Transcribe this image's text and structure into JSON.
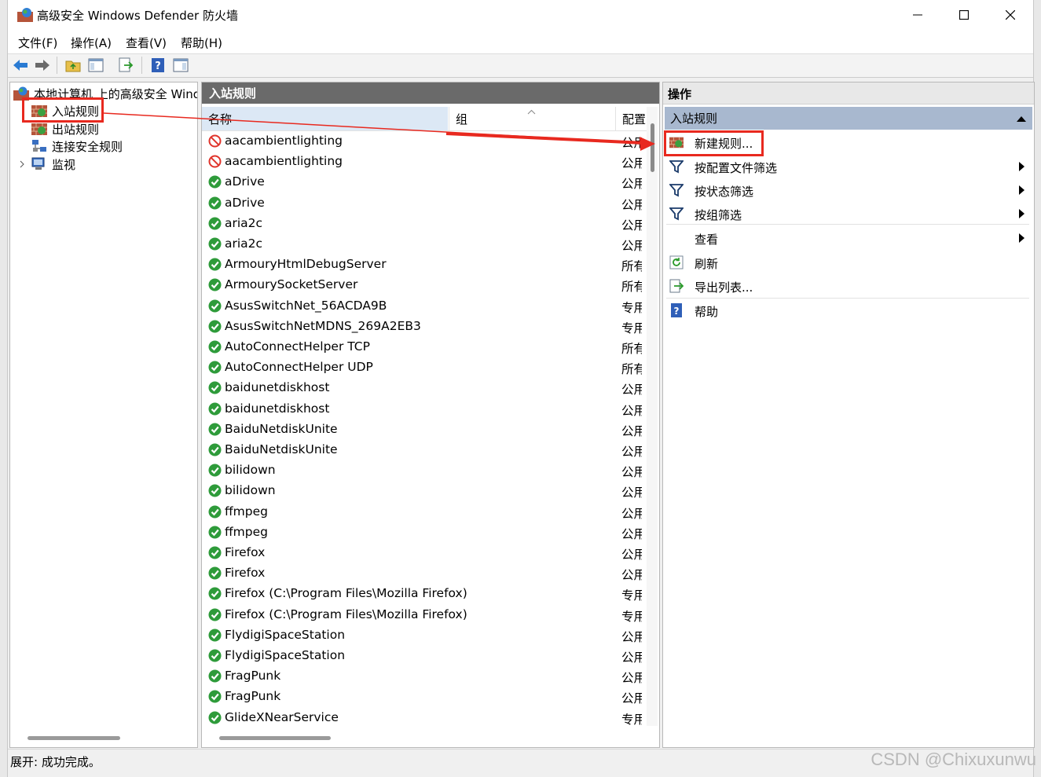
{
  "window": {
    "title": "高级安全 Windows Defender 防火墙",
    "minimize": "—",
    "maximize": "☐",
    "close": "✕"
  },
  "menu": [
    "文件(F)",
    "操作(A)",
    "查看(V)",
    "帮助(H)"
  ],
  "tree": {
    "root": "本地计算机 上的高级安全 Windows Defender 防火墙",
    "items": [
      {
        "label": "入站规则"
      },
      {
        "label": "出站规则"
      },
      {
        "label": "连接安全规则"
      },
      {
        "label": "监视"
      }
    ]
  },
  "middle": {
    "header": "入站规则",
    "columns": {
      "name": "名称",
      "group": "组",
      "profile": "配置"
    },
    "rows": [
      {
        "name": "aacambientlighting",
        "profile": "公用",
        "status": "block"
      },
      {
        "name": "aacambientlighting",
        "profile": "公用",
        "status": "block"
      },
      {
        "name": "aDrive",
        "profile": "公用",
        "status": "allow"
      },
      {
        "name": "aDrive",
        "profile": "公用",
        "status": "allow"
      },
      {
        "name": "aria2c",
        "profile": "公用",
        "status": "allow"
      },
      {
        "name": "aria2c",
        "profile": "公用",
        "status": "allow"
      },
      {
        "name": "ArmouryHtmlDebugServer",
        "profile": "所有",
        "status": "allow"
      },
      {
        "name": "ArmourySocketServer",
        "profile": "所有",
        "status": "allow"
      },
      {
        "name": "AsusSwitchNet_56ACDA9B",
        "profile": "专用",
        "status": "allow"
      },
      {
        "name": "AsusSwitchNetMDNS_269A2EB3",
        "profile": "专用",
        "status": "allow"
      },
      {
        "name": "AutoConnectHelper TCP",
        "profile": "所有",
        "status": "allow"
      },
      {
        "name": "AutoConnectHelper UDP",
        "profile": "所有",
        "status": "allow"
      },
      {
        "name": "baidunetdiskhost",
        "profile": "公用",
        "status": "allow"
      },
      {
        "name": "baidunetdiskhost",
        "profile": "公用",
        "status": "allow"
      },
      {
        "name": "BaiduNetdiskUnite",
        "profile": "公用",
        "status": "allow"
      },
      {
        "name": "BaiduNetdiskUnite",
        "profile": "公用",
        "status": "allow"
      },
      {
        "name": "bilidown",
        "profile": "公用",
        "status": "allow"
      },
      {
        "name": "bilidown",
        "profile": "公用",
        "status": "allow"
      },
      {
        "name": "ffmpeg",
        "profile": "公用",
        "status": "allow"
      },
      {
        "name": "ffmpeg",
        "profile": "公用",
        "status": "allow"
      },
      {
        "name": "Firefox",
        "profile": "公用",
        "status": "allow"
      },
      {
        "name": "Firefox",
        "profile": "公用",
        "status": "allow"
      },
      {
        "name": "Firefox (C:\\Program Files\\Mozilla Firefox)",
        "profile": "专用",
        "status": "allow"
      },
      {
        "name": "Firefox (C:\\Program Files\\Mozilla Firefox)",
        "profile": "专用",
        "status": "allow"
      },
      {
        "name": "FlydigiSpaceStation",
        "profile": "公用",
        "status": "allow"
      },
      {
        "name": "FlydigiSpaceStation",
        "profile": "公用",
        "status": "allow"
      },
      {
        "name": "FragPunk",
        "profile": "公用",
        "status": "allow"
      },
      {
        "name": "FragPunk",
        "profile": "公用",
        "status": "allow"
      },
      {
        "name": "GlideXNearService",
        "profile": "专用",
        "status": "allow"
      }
    ]
  },
  "actions": {
    "header": "操作",
    "section": "入站规则",
    "items": [
      {
        "label": "新建规则...",
        "icon": "new-rule-icon",
        "submenu": false
      },
      {
        "label": "按配置文件筛选",
        "icon": "filter-icon",
        "submenu": true
      },
      {
        "label": "按状态筛选",
        "icon": "filter-icon",
        "submenu": true
      },
      {
        "label": "按组筛选",
        "icon": "filter-icon",
        "submenu": true
      },
      {
        "label": "查看",
        "icon": "",
        "submenu": true
      },
      {
        "label": "刷新",
        "icon": "refresh-icon",
        "submenu": false
      },
      {
        "label": "导出列表...",
        "icon": "export-icon",
        "submenu": false
      },
      {
        "label": "帮助",
        "icon": "help-icon",
        "submenu": false
      }
    ]
  },
  "status": "展开: 成功完成。",
  "watermark": "CSDN @Chixuxunwu",
  "colors": {
    "annotation": "#e8291f",
    "section": "#a8b8cf",
    "header": "#6a6a6a"
  }
}
